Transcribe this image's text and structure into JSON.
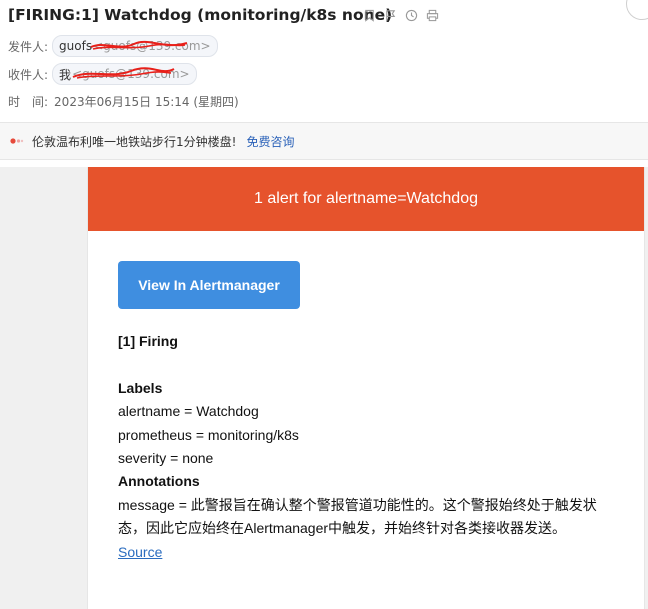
{
  "mail": {
    "subject": "[FIRING:1] Watchdog (monitoring/k8s none)",
    "sender_label": "发件人:",
    "sender_name": "guofs",
    "sender_address": "<guofs@139.com>",
    "recipient_label": "收件人:",
    "recipient_name": "我",
    "recipient_address": "<guofs@139.com>",
    "time_label": "时　间:",
    "time_value": "2023年06月15日 15:14 (星期四)"
  },
  "ad": {
    "text": "伦敦温布利唯一地铁站步行1分钟楼盘!",
    "link": "免费咨询"
  },
  "email_body": {
    "banner": "1 alert for alertname=Watchdog",
    "button": "View In Alertmanager",
    "firing": "[1] Firing",
    "labels_heading": "Labels",
    "labels": [
      "alertname = Watchdog",
      "prometheus = monitoring/k8s",
      "severity = none"
    ],
    "annotations_heading": "Annotations",
    "message": "message = 此警报旨在确认整个警报管道功能性的。这个警报始终处于触发状态，因此它应始终在Alertmanager中触发，并始终针对各类接收器发送。",
    "source": "Source"
  },
  "colors": {
    "banner": "#e6532c",
    "button": "#3f8ee0",
    "link": "#2a6cbf"
  },
  "icons": [
    "bookmark-icon",
    "flag-icon",
    "clock-icon",
    "printer-icon"
  ]
}
